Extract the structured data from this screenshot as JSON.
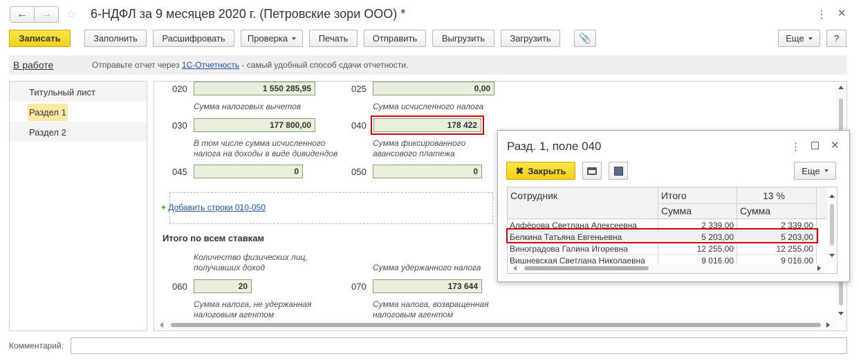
{
  "window": {
    "title": "6-НДФЛ за 9 месяцев 2020 г. (Петровские зори ООО) *",
    "back_icon": "arrow-left-icon",
    "forward_icon": "arrow-right-icon",
    "star_icon": "star-icon"
  },
  "toolbar": {
    "save": "Записать",
    "fill": "Заполнить",
    "decode": "Расшифровать",
    "check": "Проверка",
    "print": "Печать",
    "send": "Отправить",
    "export": "Выгрузить",
    "import": "Загрузить",
    "more": "Еще",
    "help": "?"
  },
  "status": {
    "state": "В работе",
    "msg_before": "Отправьте отчет через",
    "msg_link": "1С-Отчетность",
    "msg_after": "- самый удобный способ сдачи отчетности."
  },
  "sidebar": {
    "items": [
      {
        "label": "Титульный лист"
      },
      {
        "label": "Раздел 1"
      },
      {
        "label": "Раздел 2"
      }
    ]
  },
  "form": {
    "f020": {
      "code": "020",
      "value": "1 550 285,95"
    },
    "f025": {
      "code": "025",
      "value": "0,00"
    },
    "hint_030": "Сумма налоговых вычетов",
    "hint_040": "Сумма исчисленного налога",
    "f030": {
      "code": "030",
      "value": "177 800,00"
    },
    "f040": {
      "code": "040",
      "value": "178 422"
    },
    "hint_045_l1": "В том числе сумма исчисленного",
    "hint_045_l2": "налога на доходы в виде дивидендов",
    "hint_050_l1": "Сумма фиксированного",
    "hint_050_l2": "авансового платежа",
    "f045": {
      "code": "045",
      "value": "0"
    },
    "f050": {
      "code": "050",
      "value": "0"
    },
    "add_rows": "Добавить строки 010-050",
    "total_heading": "Итого по всем ставкам",
    "hint_060_l1": "Количество физических лиц,",
    "hint_060_l2": "получивших доход",
    "hint_070": "Сумма удержанного налога",
    "f060": {
      "code": "060",
      "value": "20"
    },
    "f070": {
      "code": "070",
      "value": "173 644"
    },
    "hint_080_l1": "Сумма налога, не удержанная",
    "hint_080_l2": "налоговым агентом",
    "hint_090_l1": "Сумма налога, возвращенная",
    "hint_090_l2": "налоговым агентом"
  },
  "popup": {
    "title": "Разд. 1, поле 040",
    "close": "Закрыть",
    "more": "Еще",
    "headers": {
      "employee": "Сотрудник",
      "total": "Итого",
      "rate": "13 %",
      "sum1": "Сумма",
      "sum2": "Сумма"
    },
    "rows": [
      {
        "name": "Алфёрова Светлана Алексеевна",
        "total": "2 339,00",
        "rate": "2 339,00"
      },
      {
        "name": "Белкина Татьяна Евгеньевна",
        "total": "5 203,00",
        "rate": "5 203,00"
      },
      {
        "name": "Виноградова Галина Игоревна",
        "total": "12 255,00",
        "rate": "12 255,00"
      },
      {
        "name": "Вишневская Светлана Николаевна",
        "total": "9 016,00",
        "rate": "9 016,00"
      }
    ]
  },
  "comment": {
    "label": "Комментарий:",
    "value": ""
  },
  "colors": {
    "accent_yellow": "#f4d01a",
    "field_green": "#e6f0da",
    "highlight_red": "#d10000",
    "link_blue": "#1c4f9c"
  }
}
